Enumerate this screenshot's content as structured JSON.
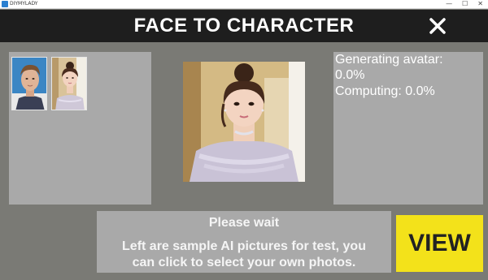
{
  "window": {
    "title": "DIYMYLADY",
    "minimize_glyph": "—",
    "maximize_glyph": "☐",
    "close_glyph": "✕"
  },
  "header": {
    "title": "FACE TO CHARACTER",
    "close_icon": "close-x-icon"
  },
  "samples": [
    {
      "name": "sample-man-photo",
      "description_icon": "portrait-man"
    },
    {
      "name": "sample-woman-photo",
      "description_icon": "portrait-woman"
    }
  ],
  "status": {
    "generating_label": "Generating avatar:",
    "generating_value": "0.0%",
    "computing_label": "Computing: 0.0%"
  },
  "message": {
    "title": "Please wait",
    "body_line1": "Left are sample AI pictures for test, you",
    "body_line2": "can click to select your own photos."
  },
  "view_button": {
    "label": "VIEW"
  },
  "colors": {
    "background": "#7a7a75",
    "panel": "#a9a9a9",
    "header": "#1e1e1e",
    "accent": "#f3e21a"
  }
}
